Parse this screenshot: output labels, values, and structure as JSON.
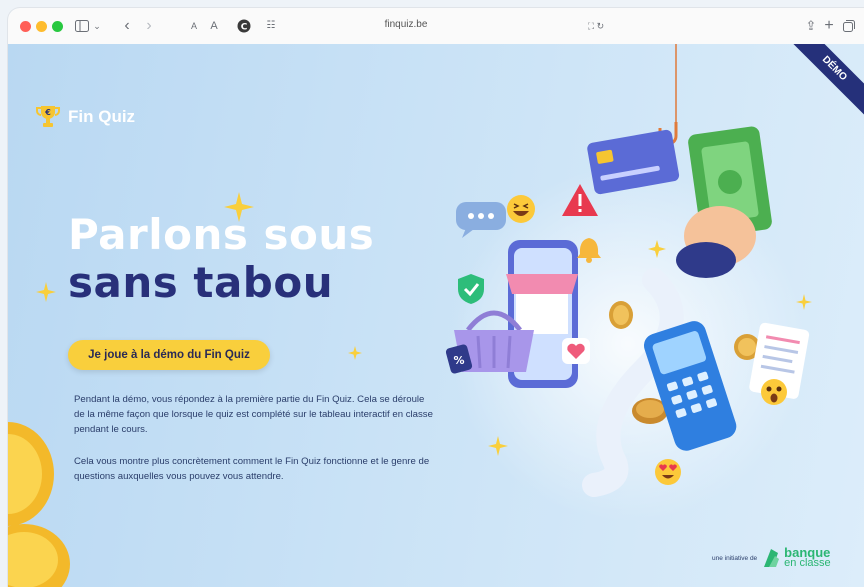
{
  "browser": {
    "url": "finquiz.be"
  },
  "logo": {
    "text": "Fin Quiz"
  },
  "hero": {
    "title_line1": "Parlons sous",
    "title_line2": "sans tabou",
    "cta_label": "Je joue à la démo du Fin Quiz",
    "paragraph1": "Pendant la démo, vous répondez à la première partie du Fin Quiz. Cela se déroule de la même façon que lorsque le quiz est complété sur le tableau interactif en classe pendant le cours.",
    "paragraph2": "Cela vous montre plus concrètement comment le Fin Quiz fonctionne et le genre de questions auxquelles vous pouvez vous attendre."
  },
  "badge": {
    "demo": "DÉMO"
  },
  "footer": {
    "initiative": "une initiative de",
    "brand_line1": "banque",
    "brand_line2": "en classe"
  },
  "colors": {
    "accent_yellow": "#f9cf3c",
    "navy": "#28307a",
    "brand_green": "#2bb673"
  }
}
